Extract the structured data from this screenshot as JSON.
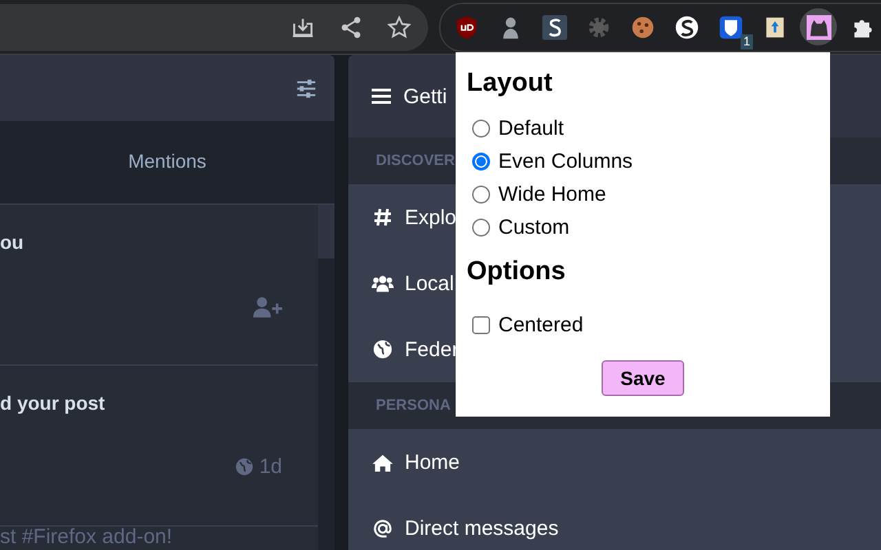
{
  "browser": {
    "extensions": [
      {
        "kind": "ublock",
        "selected": false
      },
      {
        "kind": "agent",
        "selected": false
      },
      {
        "kind": "s-square",
        "selected": false
      },
      {
        "kind": "gear",
        "selected": false
      },
      {
        "kind": "cookie",
        "selected": false
      },
      {
        "kind": "s-circle",
        "selected": false
      },
      {
        "kind": "vault",
        "selected": false,
        "badge": "1"
      },
      {
        "kind": "book",
        "selected": false
      },
      {
        "kind": "cat",
        "selected": true
      },
      {
        "kind": "puzzle",
        "selected": false
      }
    ]
  },
  "left_column": {
    "tabs": [
      {
        "label": "Mentions",
        "selected": false
      }
    ],
    "notifications": [
      {
        "title": "ou",
        "kind": "follow"
      },
      {
        "title": "d your post",
        "kind": "post",
        "time": "1d",
        "text": "st #Firefox add-on!"
      }
    ]
  },
  "right_column": {
    "header": "Getti",
    "sections": [
      {
        "heading": "DISCOVER",
        "items": [
          {
            "kind": "hash",
            "label": "Explo"
          },
          {
            "kind": "users",
            "label": "Local"
          },
          {
            "kind": "globe",
            "label": "Feder"
          }
        ]
      },
      {
        "heading": "PERSONA",
        "items": [
          {
            "kind": "home",
            "label": "Home"
          },
          {
            "kind": "at",
            "label": "Direct messages"
          }
        ]
      }
    ]
  },
  "popup": {
    "layout_heading": "Layout",
    "layouts": [
      {
        "label": "Default",
        "selected": false
      },
      {
        "label": "Even Columns",
        "selected": true
      },
      {
        "label": "Wide Home",
        "selected": false
      },
      {
        "label": "Custom",
        "selected": false
      }
    ],
    "options_heading": "Options",
    "options": [
      {
        "label": "Centered",
        "checked": false
      }
    ],
    "save": "Save"
  }
}
